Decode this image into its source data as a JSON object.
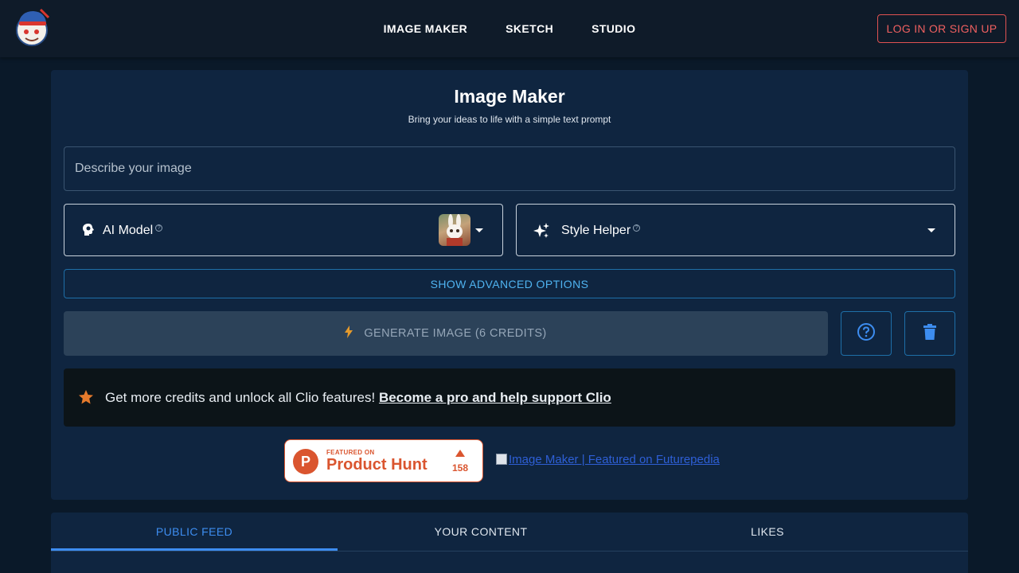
{
  "nav": {
    "links": [
      "IMAGE MAKER",
      "SKETCH",
      "STUDIO"
    ],
    "login_label": "LOG IN OR SIGN UP"
  },
  "main": {
    "title": "Image Maker",
    "subtitle": "Bring your ideas to life with a simple text prompt",
    "prompt_placeholder": "Describe your image",
    "model_label": "AI Model",
    "style_label": "Style Helper",
    "advanced_label": "SHOW ADVANCED OPTIONS",
    "generate_label": "GENERATE IMAGE (6 CREDITS)"
  },
  "promo": {
    "text": "Get more credits and unlock all Clio features!",
    "link": "Become a pro and help support Clio"
  },
  "badges": {
    "ph_featured": "FEATURED ON",
    "ph_name": "Product Hunt",
    "ph_count": "158",
    "futurepedia_alt": "Image Maker | Featured on Futurepedia"
  },
  "tabs": [
    "PUBLIC FEED",
    "YOUR CONTENT",
    "LIKES"
  ],
  "colors": {
    "accent": "#3d8df0",
    "danger": "#e05252",
    "product_hunt": "#da552f"
  }
}
